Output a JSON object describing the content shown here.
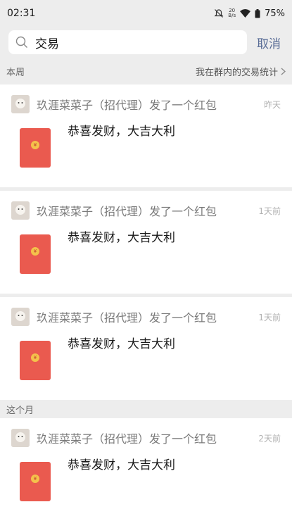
{
  "status_bar": {
    "time": "02:31",
    "net_speed_top": "20",
    "net_speed_bottom": "B/s",
    "battery": "75%"
  },
  "search": {
    "query": "交易",
    "cancel_label": "取消"
  },
  "sections": {
    "week_label": "本周",
    "stats_label": "我在群内的交易统计",
    "month_label": "这个月"
  },
  "items": [
    {
      "sender": "玖涯菜菜子（招代理）发了一个红包",
      "time": "昨天",
      "message": "恭喜发财，大吉大利"
    },
    {
      "sender": "玖涯菜菜子（招代理）发了一个红包",
      "time": "1天前",
      "message": "恭喜发财，大吉大利"
    },
    {
      "sender": "玖涯菜菜子（招代理）发了一个红包",
      "time": "1天前",
      "message": "恭喜发财，大吉大利"
    },
    {
      "sender": "玖涯菜菜子（招代理）发了一个红包",
      "time": "2天前",
      "message": "恭喜发财，大吉大利"
    }
  ],
  "colors": {
    "accent": "#576b95",
    "red_packet": "#ea5a4f",
    "background": "#ededed"
  },
  "icons": [
    "search-icon",
    "mute-icon",
    "wifi-icon",
    "battery-icon",
    "chevron-right-icon",
    "red-packet-icon"
  ]
}
